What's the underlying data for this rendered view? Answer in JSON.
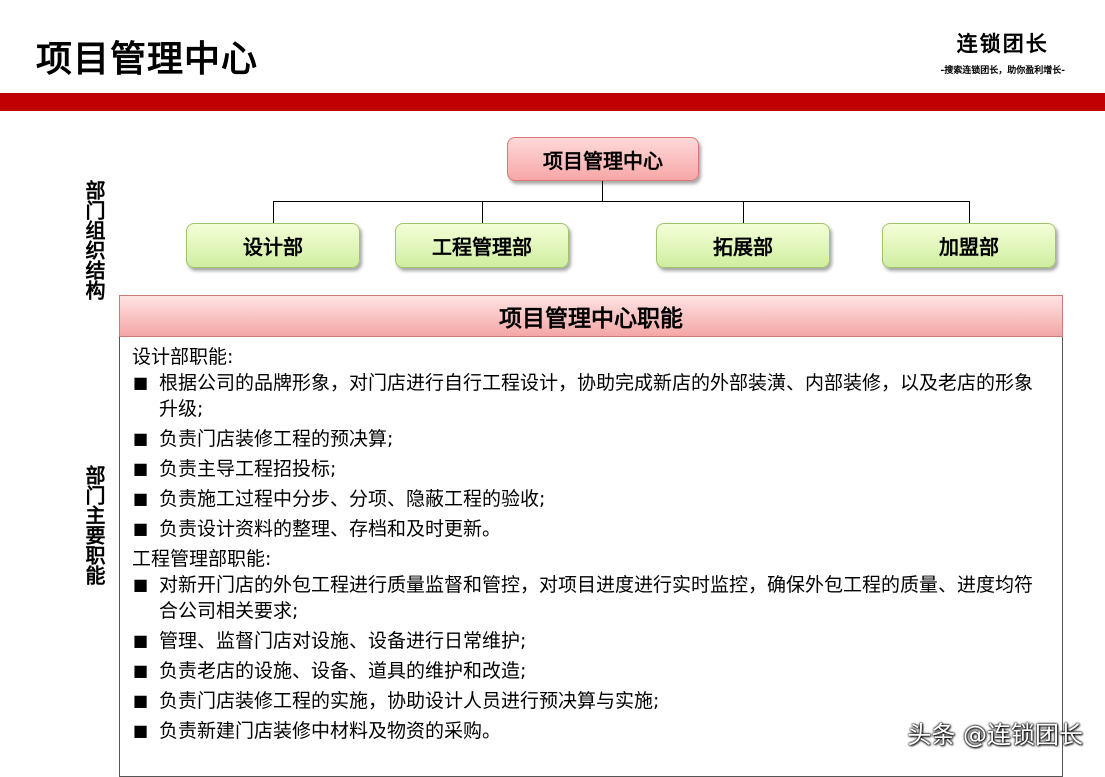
{
  "header": {
    "title": "项目管理中心",
    "brand_name": "连锁团长",
    "brand_slogan": "-搜索连锁团长，助你盈利增长-"
  },
  "side_labels": {
    "org": "部门组织结构",
    "duty": "部门主要职能"
  },
  "org_chart": {
    "root": "项目管理中心",
    "children": [
      "设计部",
      "工程管理部",
      "拓展部",
      "加盟部"
    ]
  },
  "duties": {
    "header": "项目管理中心职能",
    "sections": [
      {
        "title": "设计部职能:",
        "items": [
          "根据公司的品牌形象，对门店进行自行工程设计，协助完成新店的外部装潢、内部装修，以及老店的形象升级;",
          "负责门店装修工程的预决算;",
          "负责主导工程招投标;",
          "负责施工过程中分步、分项、隐蔽工程的验收;",
          "负责设计资料的整理、存档和及时更新。"
        ]
      },
      {
        "title": "工程管理部职能:",
        "items": [
          "对新开门店的外包工程进行质量监督和管控，对项目进度进行实时监控，确保外包工程的质量、进度均符合公司相关要求;",
          "管理、监督门店对设施、设备进行日常维护;",
          "负责老店的设施、设备、道具的维护和改造;",
          "负责门店装修工程的实施，协助设计人员进行预决算与实施;",
          "负责新建门店装修中材料及物资的采购。"
        ]
      }
    ],
    "bullet": "■"
  },
  "watermark": "头条 @连锁团长",
  "colors": {
    "red_bar": "#c00000",
    "root_node": "#f7a7a7",
    "child_node": "#cfeea0"
  }
}
